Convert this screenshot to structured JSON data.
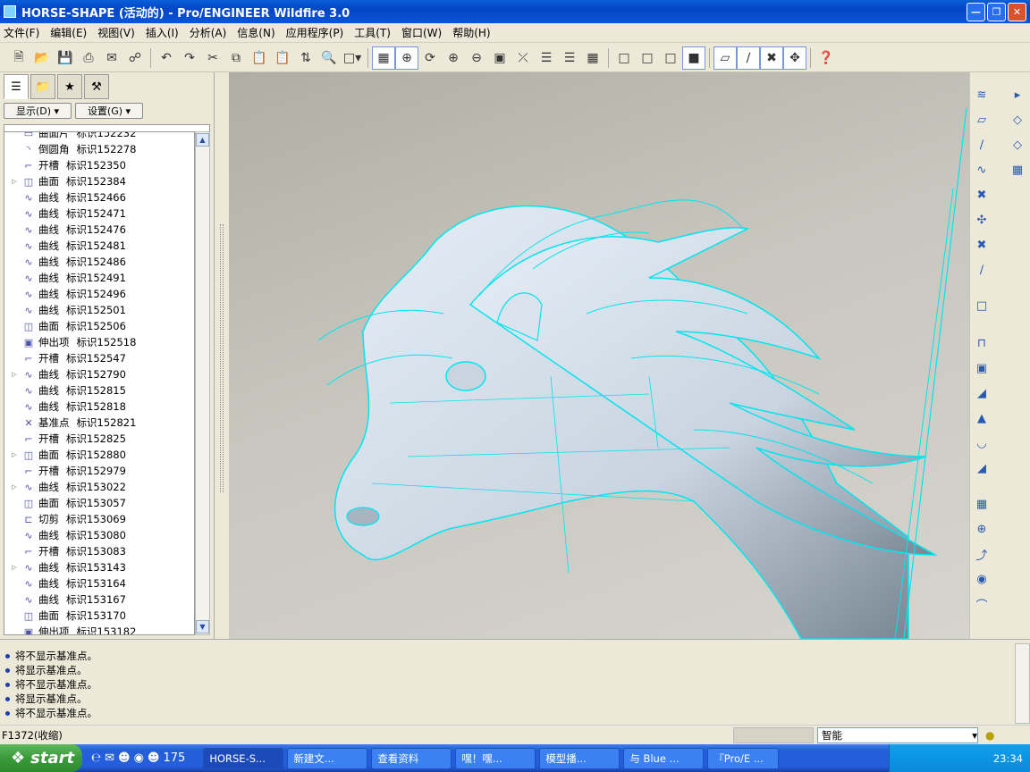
{
  "window": {
    "title": "HORSE-SHAPE (活动的) - Pro/ENGINEER Wildfire 3.0"
  },
  "menu": [
    "文件(F)",
    "编辑(E)",
    "视图(V)",
    "插入(I)",
    "分析(A)",
    "信息(N)",
    "应用程序(P)",
    "工具(T)",
    "窗口(W)",
    "帮助(H)"
  ],
  "navigator": {
    "show_label": "显示(D) ▾",
    "settings_label": "设置(G) ▾"
  },
  "tree": [
    {
      "type": "曲面片",
      "id": "标识152232",
      "expand": false
    },
    {
      "type": "倒圆角",
      "id": "标识152278",
      "expand": false
    },
    {
      "type": "开槽",
      "id": "标识152350",
      "expand": false
    },
    {
      "type": "曲面",
      "id": "标识152384",
      "expand": true
    },
    {
      "type": "曲线",
      "id": "标识152466",
      "expand": false
    },
    {
      "type": "曲线",
      "id": "标识152471",
      "expand": false
    },
    {
      "type": "曲线",
      "id": "标识152476",
      "expand": false
    },
    {
      "type": "曲线",
      "id": "标识152481",
      "expand": false
    },
    {
      "type": "曲线",
      "id": "标识152486",
      "expand": false
    },
    {
      "type": "曲线",
      "id": "标识152491",
      "expand": false
    },
    {
      "type": "曲线",
      "id": "标识152496",
      "expand": false
    },
    {
      "type": "曲线",
      "id": "标识152501",
      "expand": false
    },
    {
      "type": "曲面",
      "id": "标识152506",
      "expand": false
    },
    {
      "type": "伸出项",
      "id": "标识152518",
      "expand": false
    },
    {
      "type": "开槽",
      "id": "标识152547",
      "expand": false
    },
    {
      "type": "曲线",
      "id": "标识152790",
      "expand": true
    },
    {
      "type": "曲线",
      "id": "标识152815",
      "expand": false
    },
    {
      "type": "曲线",
      "id": "标识152818",
      "expand": false
    },
    {
      "type": "基准点",
      "id": "标识152821",
      "expand": false
    },
    {
      "type": "开槽",
      "id": "标识152825",
      "expand": false
    },
    {
      "type": "曲面",
      "id": "标识152880",
      "expand": true
    },
    {
      "type": "开槽",
      "id": "标识152979",
      "expand": false
    },
    {
      "type": "曲线",
      "id": "标识153022",
      "expand": true
    },
    {
      "type": "曲面",
      "id": "标识153057",
      "expand": false
    },
    {
      "type": "切剪",
      "id": "标识153069",
      "expand": false
    },
    {
      "type": "曲线",
      "id": "标识153080",
      "expand": false
    },
    {
      "type": "开槽",
      "id": "标识153083",
      "expand": false
    },
    {
      "type": "曲线",
      "id": "标识153143",
      "expand": true
    },
    {
      "type": "曲线",
      "id": "标识153164",
      "expand": false
    },
    {
      "type": "曲线",
      "id": "标识153167",
      "expand": false
    },
    {
      "type": "曲面",
      "id": "标识153170",
      "expand": false
    },
    {
      "type": "伸出项",
      "id": "标识153182",
      "expand": false
    }
  ],
  "messages": [
    "将不显示基准点。",
    "将显示基准点。",
    "将不显示基准点。",
    "将显示基准点。",
    "将不显示基准点。"
  ],
  "status": {
    "text": "F1372(收缩)",
    "filter": "智能"
  },
  "taskbar": {
    "start": "start",
    "quicklaunch": "175",
    "buttons": [
      "HORSE-S...",
      "新建文...",
      "查看资料",
      "嘿！嘿...",
      "模型播...",
      "与 Blue ...",
      "『Pro/E ..."
    ],
    "clock": "23:34"
  }
}
